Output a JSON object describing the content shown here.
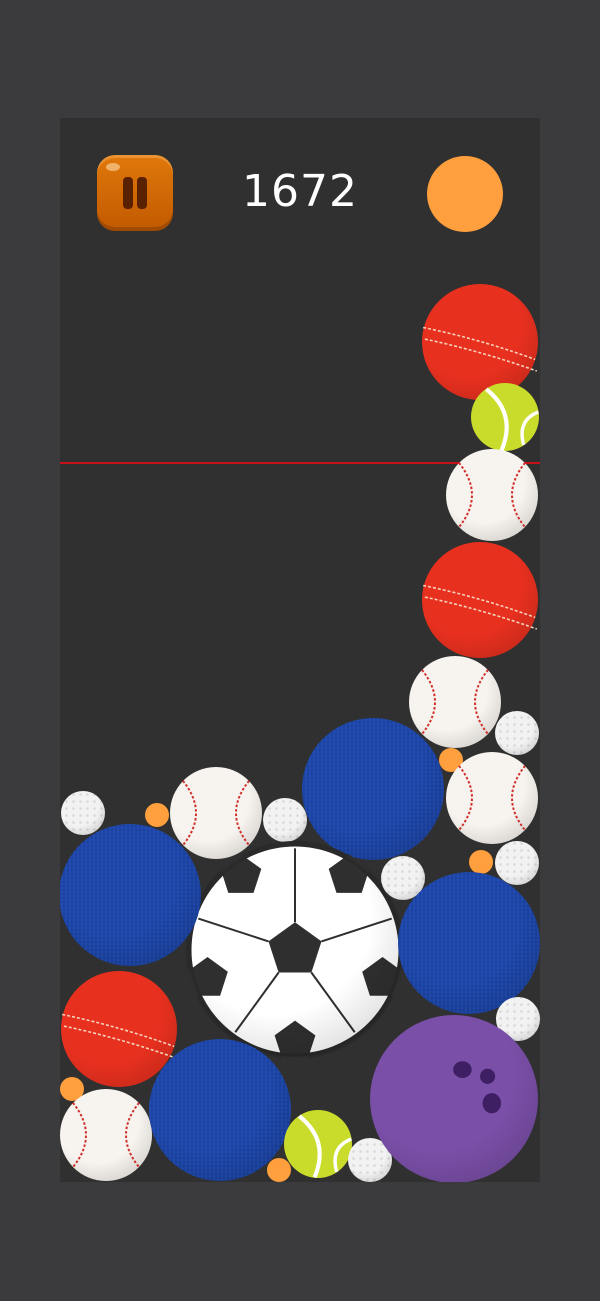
{
  "score": "1672",
  "hud": {
    "pause_icon": "pause-icon",
    "next_ball": "orange"
  },
  "colors": {
    "board": "#303030",
    "background": "#3b3b3d",
    "pause_button": "#d4690a",
    "danger_line": "#c8101a",
    "orange": "#ff9f3d",
    "cricket": "#e8301f",
    "tennis": "#c9dc2c",
    "baseball": "#f7f3ee",
    "golf": "#f2f2f2",
    "dodgeball": "#1d46a8",
    "soccer": "#ffffff",
    "bowling": "#7a4fa8"
  },
  "balls": [
    "cricket",
    "tennis",
    "baseball",
    "cricket",
    "baseball",
    "golf",
    "orange",
    "baseball",
    "dodgeball",
    "golf",
    "baseball",
    "orange",
    "golf",
    "orange",
    "golf",
    "soccer",
    "dodgeball",
    "golf",
    "dodgeball",
    "cricket",
    "orange",
    "baseball",
    "dodgeball",
    "tennis",
    "orange",
    "golf",
    "golf",
    "bowling"
  ]
}
